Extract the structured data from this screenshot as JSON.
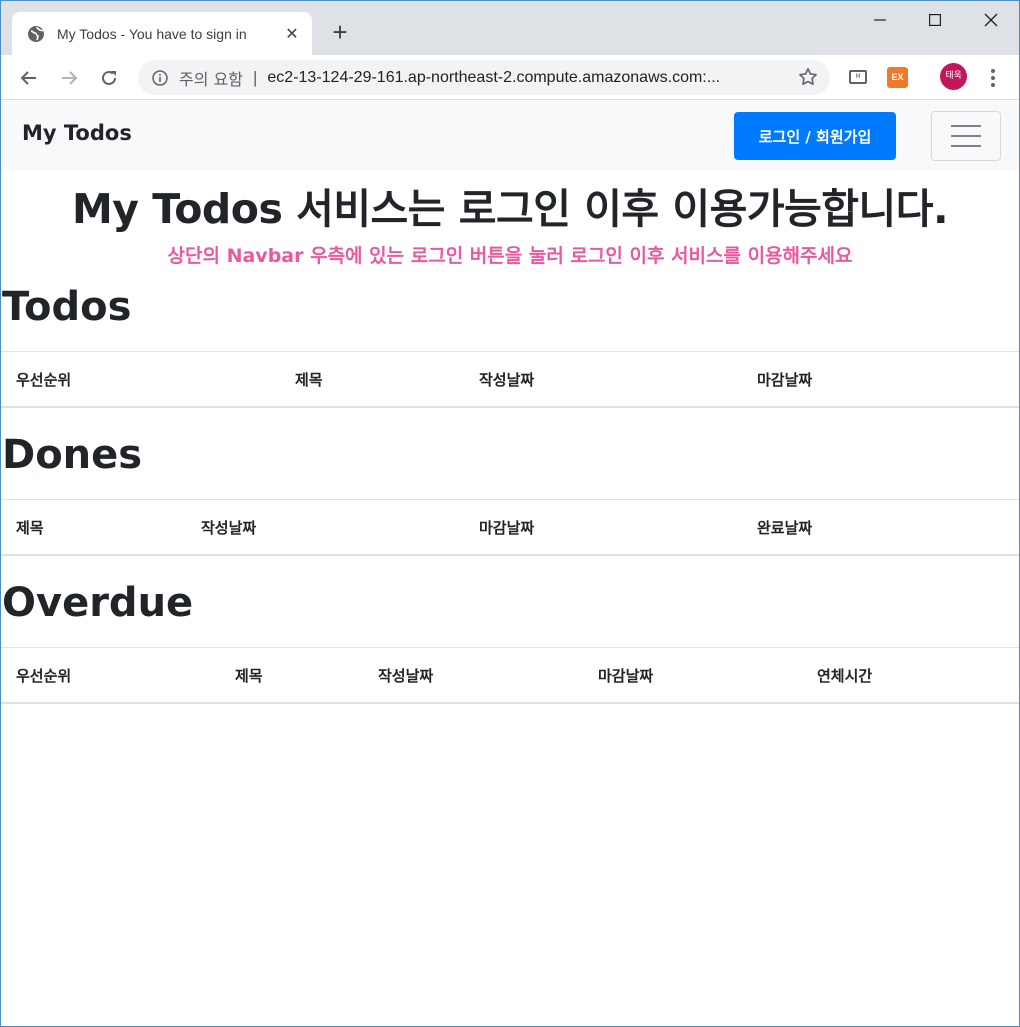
{
  "browser": {
    "tab_title": "My Todos - You have to sign in",
    "tab_close": "✕",
    "new_tab": "+",
    "security_label": "주의 요함",
    "separator": "|",
    "url": "ec2-13-124-29-161.ap-northeast-2.compute.amazonaws.com:...",
    "ext_badge": "EX",
    "profile_initials": "태욱"
  },
  "navbar": {
    "brand": "My Todos",
    "login_label": "로그인 / 회원가입"
  },
  "hero": {
    "title": "My Todos 서비스는 로그인 이후 이용가능합니다.",
    "subtitle": "상단의 Navbar 우측에 있는 로그인 버튼을 눌러 로그인 이후 서비스를 이용해주세요",
    "subtitle_color": "#e85aa0"
  },
  "sections": {
    "todos": {
      "title": "Todos",
      "columns": [
        "우선순위",
        "제목",
        "작성날짜",
        "마감날짜"
      ]
    },
    "dones": {
      "title": "Dones",
      "columns": [
        "제목",
        "작성날짜",
        "마감날짜",
        "완료날짜"
      ]
    },
    "overdue": {
      "title": "Overdue",
      "columns": [
        "우선순위",
        "제목",
        "작성날짜",
        "마감날짜",
        "연체시간"
      ]
    }
  },
  "colors": {
    "primary": "#007bff",
    "navbar_bg": "#f8f9fa",
    "text": "#212529"
  },
  "icons": [
    "globe-icon",
    "close-icon",
    "plus-icon",
    "minimize-icon",
    "maximize-icon",
    "window-close-icon",
    "back-arrow-icon",
    "forward-arrow-icon",
    "reload-icon",
    "info-icon",
    "star-icon",
    "cast-icon",
    "extension-icon",
    "more-icon",
    "hamburger-icon"
  ]
}
